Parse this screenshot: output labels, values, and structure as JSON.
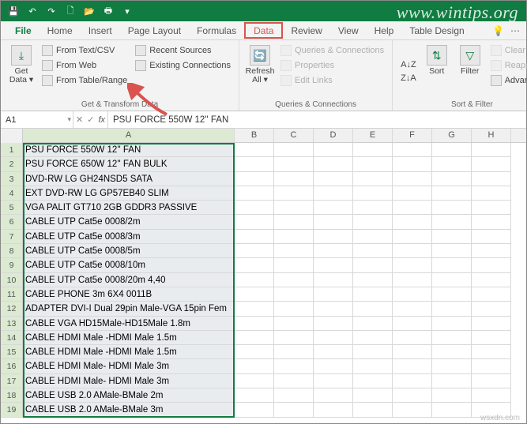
{
  "qat": {
    "save": "💾",
    "undo": "↶",
    "redo": "↷",
    "new": "🗋",
    "open": "📂",
    "print": "🖶"
  },
  "watermark": "www.wintips.org",
  "menu": {
    "file": "File",
    "home": "Home",
    "insert": "Insert",
    "pagelayout": "Page Layout",
    "formulas": "Formulas",
    "data": "Data",
    "review": "Review",
    "view": "View",
    "help": "Help",
    "tabledesign": "Table Design"
  },
  "ribbon": {
    "getdata": {
      "label": "Get\nData ▾",
      "icon": "⤓"
    },
    "fromtext": "From Text/CSV",
    "fromweb": "From Web",
    "fromtable": "From Table/Range",
    "recent": "Recent Sources",
    "existing": "Existing Connections",
    "group1": "Get & Transform Data",
    "refresh": {
      "label": "Refresh\nAll ▾",
      "icon": "🔄"
    },
    "queries": "Queries & Connections",
    "properties": "Properties",
    "editlinks": "Edit Links",
    "group2": "Queries & Connections",
    "sort": {
      "az": "A↓Z",
      "za": "Z↓A",
      "label": "Sort"
    },
    "filter": "Filter",
    "clear": "Clear",
    "reapply": "Reapply",
    "advanced": "Advanced",
    "group3": "Sort & Filter"
  },
  "namebox": "A1",
  "formula": "PSU FORCE 550W 12'' FAN",
  "cols": [
    "A",
    "B",
    "C",
    "D",
    "E",
    "F",
    "G",
    "H"
  ],
  "rows": [
    {
      "n": 1,
      "a": "PSU FORCE 550W 12'' FAN"
    },
    {
      "n": 2,
      "a": "PSU FORCE 650W 12'' FAN BULK"
    },
    {
      "n": 3,
      "a": "DVD-RW LG GH24NSD5 SATA"
    },
    {
      "n": 4,
      "a": "EXT DVD-RW LG GP57EB40 SLIM"
    },
    {
      "n": 5,
      "a": "VGA PALIT GT710 2GB GDDR3 PASSIVE"
    },
    {
      "n": 6,
      "a": "CABLE UTP Cat5e 0008/2m"
    },
    {
      "n": 7,
      "a": "CABLE UTP Cat5e 0008/3m"
    },
    {
      "n": 8,
      "a": "CABLE UTP Cat5e 0008/5m"
    },
    {
      "n": 9,
      "a": "CABLE UTP Cat5e 0008/10m"
    },
    {
      "n": 10,
      "a": "CABLE UTP Cat5e 0008/20m 4,40"
    },
    {
      "n": 11,
      "a": "CABLE PHONE 3m 6X4 0011B"
    },
    {
      "n": 12,
      "a": "ADAPTER DVI-I Dual 29pin Male-VGA 15pin Fem"
    },
    {
      "n": 13,
      "a": "CABLE VGA HD15Male-HD15Male 1.8m"
    },
    {
      "n": 14,
      "a": "CABLE HDMI Male -HDMI Male 1.5m"
    },
    {
      "n": 15,
      "a": "CABLE HDMI Male -HDMI Male 1.5m"
    },
    {
      "n": 16,
      "a": "CABLE HDMI Male- HDMI Male 3m"
    },
    {
      "n": 17,
      "a": "CABLE HDMI Male- HDMI Male 3m"
    },
    {
      "n": 18,
      "a": "CABLE USB 2.0 AMale-BMale 2m"
    },
    {
      "n": 19,
      "a": "CABLE USB 2.0 AMale-BMale 3m"
    }
  ],
  "source": "wsxdn.com"
}
